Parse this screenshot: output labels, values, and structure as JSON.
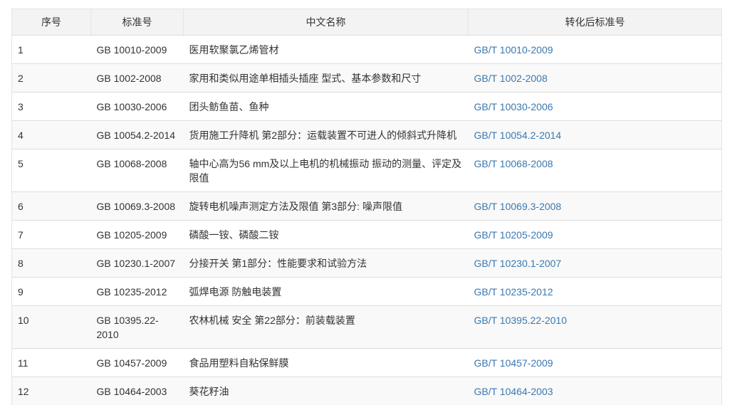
{
  "table": {
    "headers": {
      "index": "序号",
      "standard": "标准号",
      "chinese_name": "中文名称",
      "converted": "转化后标准号"
    },
    "rows": [
      {
        "index": "1",
        "standard": "GB 10010-2009",
        "name": "医用软聚氯乙烯管材",
        "converted": "GB/T 10010-2009"
      },
      {
        "index": "2",
        "standard": "GB 1002-2008",
        "name": "家用和类似用途单相插头插座  型式、基本参数和尺寸",
        "converted": "GB/T 1002-2008"
      },
      {
        "index": "3",
        "standard": "GB 10030-2006",
        "name": "团头鲂鱼苗、鱼种",
        "converted": "GB/T 10030-2006"
      },
      {
        "index": "4",
        "standard": "GB 10054.2-2014",
        "name": "货用施工升降机  第2部分：运载装置不可进人的倾斜式升降机",
        "converted": "GB/T 10054.2-2014"
      },
      {
        "index": "5",
        "standard": "GB 10068-2008",
        "name": "轴中心高为56 mm及以上电机的机械振动  振动的测量、评定及限值",
        "converted": "GB/T 10068-2008"
      },
      {
        "index": "6",
        "standard": "GB 10069.3-2008",
        "name": "旋转电机噪声测定方法及限值  第3部分: 噪声限值",
        "converted": "GB/T 10069.3-2008"
      },
      {
        "index": "7",
        "standard": "GB 10205-2009",
        "name": "磷酸一铵、磷酸二铵",
        "converted": "GB/T 10205-2009"
      },
      {
        "index": "8",
        "standard": "GB 10230.1-2007",
        "name": "分接开关 第1部分：性能要求和试验方法",
        "converted": "GB/T 10230.1-2007"
      },
      {
        "index": "9",
        "standard": "GB 10235-2012",
        "name": "弧焊电源  防触电装置",
        "converted": "GB/T 10235-2012"
      },
      {
        "index": "10",
        "standard": "GB 10395.22-2010",
        "name": "农林机械  安全  第22部分：前装载装置",
        "converted": "GB/T 10395.22-2010"
      },
      {
        "index": "11",
        "standard": "GB 10457-2009",
        "name": "食品用塑料自粘保鲜膜",
        "converted": "GB/T 10457-2009"
      },
      {
        "index": "12",
        "standard": "GB 10464-2003",
        "name": "葵花籽油",
        "converted": "GB/T 10464-2003"
      }
    ]
  }
}
